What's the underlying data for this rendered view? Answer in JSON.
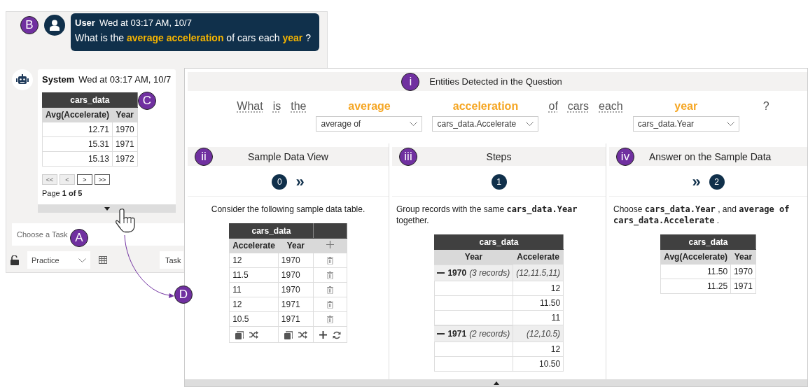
{
  "chat": {
    "messages": [
      {
        "kind": "user",
        "marker": "B",
        "sender": "User",
        "time": "Wed at 03:17 AM, 10/7",
        "text": "What is the **average acceleration** of cars each **year** ?"
      },
      {
        "kind": "system",
        "marker": "C",
        "sender": "System",
        "time": "Wed at 03:17 AM, 10/7",
        "table": {
          "kind": "plain",
          "title": "cars_data",
          "columns": [
            "Avg(Accelerate)",
            "Year"
          ],
          "rows": [
            [
              "12.71",
              "1970"
            ],
            [
              "15.31",
              "1971"
            ],
            [
              "15.13",
              "1972"
            ]
          ]
        },
        "pager": {
          "buttons": [
            {
              "label": "<<",
              "disabled": true
            },
            {
              "label": "<",
              "disabled": true
            },
            {
              "label": ">",
              "disabled": false
            },
            {
              "label": ">>",
              "disabled": false
            }
          ],
          "page": "Page **1 of 5**"
        }
      }
    ],
    "task_input": {
      "placeholder": "Choose a Task",
      "marker": "A"
    },
    "mode_select": {
      "value": "Practice"
    },
    "task_button": "Task"
  },
  "details": {
    "marker": "D",
    "entities": {
      "marker": "i",
      "title": "Entities Detected in the Question",
      "tokens": [
        {
          "kind": "word",
          "text": "What"
        },
        {
          "kind": "word",
          "text": "is"
        },
        {
          "kind": "word",
          "text": "the"
        },
        {
          "kind": "entity",
          "text": "average",
          "mapping": "average of"
        },
        {
          "kind": "entity",
          "text": "acceleration",
          "mapping": "cars_data.Accelerate"
        },
        {
          "kind": "word",
          "text": "of"
        },
        {
          "kind": "word",
          "text": "cars"
        },
        {
          "kind": "word",
          "text": "each"
        },
        {
          "kind": "entity",
          "text": "year",
          "mapping": "cars_data.Year"
        },
        {
          "kind": "punct",
          "text": "?"
        }
      ]
    },
    "panels": [
      {
        "marker": "ii",
        "title": "Sample Data View",
        "nav": [
          {
            "kind": "step",
            "label": "0"
          },
          {
            "kind": "next",
            "label": "»"
          }
        ],
        "description": "Consider the following sample data table.",
        "table": {
          "kind": "editable",
          "title": "cars_data",
          "columns": [
            "Accelerate",
            "Year"
          ],
          "rows": [
            [
              "12",
              "1970"
            ],
            [
              "11.5",
              "1970"
            ],
            [
              "11",
              "1970"
            ],
            [
              "12",
              "1971"
            ],
            [
              "10.5",
              "1971"
            ]
          ]
        }
      },
      {
        "marker": "iii",
        "title": "Steps",
        "nav": [
          {
            "kind": "step",
            "label": "1"
          }
        ],
        "description": "Group records with the same **cars_data.Year** together.",
        "table": {
          "kind": "grouped",
          "title": "cars_data",
          "columns": [
            "Year",
            "Accelerate"
          ],
          "groups": [
            {
              "key": "1970",
              "count": "(3 records)",
              "summary": "(12,11.5,11)",
              "expanded": true,
              "rows": [
                "12",
                "11.50",
                "11"
              ]
            },
            {
              "key": "1971",
              "count": "(2 records)",
              "summary": "(12,10.5)",
              "expanded": true,
              "rows": [
                "12",
                "10.50"
              ]
            }
          ]
        }
      },
      {
        "marker": "iv",
        "title": "Answer on the Sample Data",
        "nav": [
          {
            "kind": "next",
            "label": "»"
          },
          {
            "kind": "step",
            "label": "2"
          }
        ],
        "description": "Choose **cars_data.Year** , and **average of** **cars_data.Accelerate** .",
        "table": {
          "kind": "plain",
          "title": "cars_data",
          "columns": [
            "Avg(Accelerate)",
            "Year"
          ],
          "rows": [
            [
              "11.50",
              "1970"
            ],
            [
              "11.25",
              "1971"
            ]
          ]
        }
      }
    ]
  }
}
